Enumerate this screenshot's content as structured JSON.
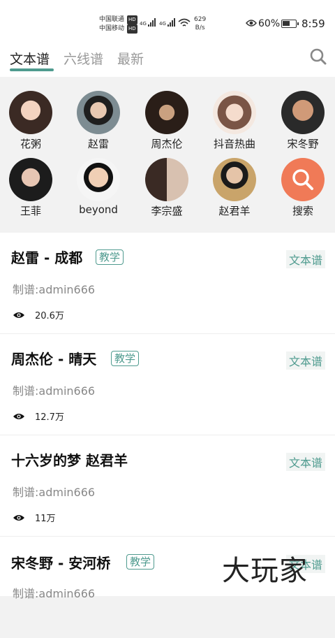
{
  "status_bar": {
    "carrier1": "中国联通",
    "carrier2": "中国移动",
    "hd": "HD",
    "net_type": "4G",
    "net_speed_value": "629",
    "net_speed_unit": "B/s",
    "battery_pct": "60%",
    "battery_level": 0.6,
    "time": "8:59"
  },
  "tabs": [
    {
      "label": "文本谱",
      "active": true
    },
    {
      "label": "六线谱",
      "active": false
    },
    {
      "label": "最新",
      "active": false
    }
  ],
  "artists": [
    {
      "name": "花粥"
    },
    {
      "name": "赵雷"
    },
    {
      "name": "周杰伦"
    },
    {
      "name": "抖音热曲"
    },
    {
      "name": "宋冬野"
    },
    {
      "name": "王菲"
    },
    {
      "name": "beyond"
    },
    {
      "name": "李宗盛"
    },
    {
      "name": "赵君羊"
    },
    {
      "name": "搜索"
    }
  ],
  "songs": [
    {
      "title": "赵雷 - 成都",
      "tag": "教学",
      "type": "文本谱",
      "author": "制谱:admin666",
      "views": "20.6万"
    },
    {
      "title": "周杰伦 - 晴天",
      "tag": "教学",
      "type": "文本谱",
      "author": "制谱:admin666",
      "views": "12.7万"
    },
    {
      "title": "十六岁的梦 赵君羊",
      "tag": "",
      "type": "文本谱",
      "author": "制谱:admin666",
      "views": "11万"
    },
    {
      "title": "宋冬野 - 安河桥",
      "tag": "教学",
      "type": "文本谱",
      "author": "制谱:admin666",
      "views": ""
    }
  ],
  "watermark": "大玩家",
  "colors": {
    "accent": "#4f9b8f",
    "search_button": "#f07a57"
  }
}
